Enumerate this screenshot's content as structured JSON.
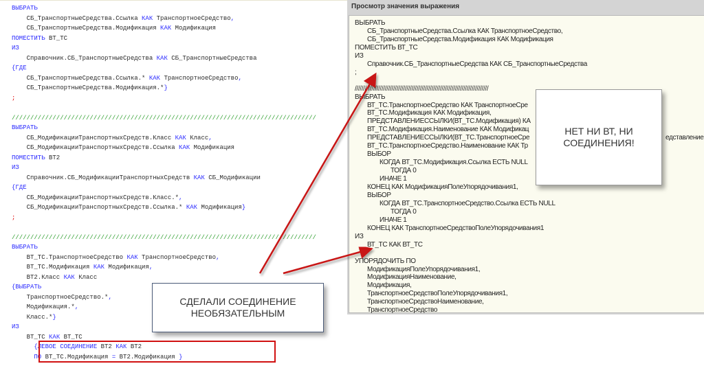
{
  "left_code": [
    [
      [
        "ВЫБРАТЬ",
        "kw"
      ]
    ],
    [
      [
        "    СБ_ТранспортныеСредства.Ссылка ",
        "id"
      ],
      [
        "КАК",
        "kw"
      ],
      [
        " ТранспортноеСредство",
        "id"
      ],
      [
        ",",
        "op"
      ]
    ],
    [
      [
        "    СБ_ТранспортныеСредства.Модификация ",
        "id"
      ],
      [
        "КАК",
        "kw"
      ],
      [
        " Модификация",
        "id"
      ]
    ],
    [
      [
        "ПОМЕСТИТЬ",
        "kw"
      ],
      [
        " ВТ_ТС",
        "id"
      ]
    ],
    [
      [
        "ИЗ",
        "kw"
      ]
    ],
    [
      [
        "    Справочник.СБ_ТранспортныеСредства ",
        "id"
      ],
      [
        "КАК",
        "kw"
      ],
      [
        " СБ_ТранспортныеСредства",
        "id"
      ]
    ],
    [
      [
        "{ГДЕ",
        "op"
      ]
    ],
    [
      [
        "    СБ_ТранспортныеСредства.Ссылка.* ",
        "id"
      ],
      [
        "КАК",
        "kw"
      ],
      [
        " ТранспортноеСредство",
        "id"
      ],
      [
        ",",
        "op"
      ]
    ],
    [
      [
        "    СБ_ТранспортныеСредства.Модификация.*",
        "id"
      ],
      [
        "}",
        "op"
      ]
    ],
    [
      [
        ";",
        "sc"
      ]
    ],
    [],
    [
      [
        "//////////////////////////////////////////////////////////////////////////////////",
        "cm"
      ]
    ],
    [
      [
        "ВЫБРАТЬ",
        "kw"
      ]
    ],
    [
      [
        "    СБ_МодификацииТранспортныхСредств.Класс ",
        "id"
      ],
      [
        "КАК",
        "kw"
      ],
      [
        " Класс",
        "id"
      ],
      [
        ",",
        "op"
      ]
    ],
    [
      [
        "    СБ_МодификацииТранспортныхСредств.Ссылка ",
        "id"
      ],
      [
        "КАК",
        "kw"
      ],
      [
        " Модификация",
        "id"
      ]
    ],
    [
      [
        "ПОМЕСТИТЬ",
        "kw"
      ],
      [
        " ВТ2",
        "id"
      ]
    ],
    [
      [
        "ИЗ",
        "kw"
      ]
    ],
    [
      [
        "    Справочник.СБ_МодификацииТранспортныхСредств ",
        "id"
      ],
      [
        "КАК",
        "kw"
      ],
      [
        " СБ_Модификации",
        "id"
      ]
    ],
    [
      [
        "{ГДЕ",
        "op"
      ]
    ],
    [
      [
        "    СБ_МодификацииТранспортныхСредств.Класс.*",
        "id"
      ],
      [
        ",",
        "op"
      ]
    ],
    [
      [
        "    СБ_МодификацииТранспортныхСредств.Ссылка.* ",
        "id"
      ],
      [
        "КАК",
        "kw"
      ],
      [
        " Модификация",
        "id"
      ],
      [
        "}",
        "op"
      ]
    ],
    [
      [
        ";",
        "sc"
      ]
    ],
    [],
    [
      [
        "//////////////////////////////////////////////////////////////////////////////////",
        "cm"
      ]
    ],
    [
      [
        "ВЫБРАТЬ",
        "kw"
      ]
    ],
    [
      [
        "    ВТ_ТС.ТранспортноеСредство ",
        "id"
      ],
      [
        "КАК",
        "kw"
      ],
      [
        " ТранспортноеСредство",
        "id"
      ],
      [
        ",",
        "op"
      ]
    ],
    [
      [
        "    ВТ_ТС.Модификация ",
        "id"
      ],
      [
        "КАК",
        "kw"
      ],
      [
        " Модификация",
        "id"
      ],
      [
        ",",
        "op"
      ]
    ],
    [
      [
        "    ВТ2.Класс ",
        "id"
      ],
      [
        "КАК",
        "kw"
      ],
      [
        " Класс",
        "id"
      ]
    ],
    [
      [
        "{ВЫБРАТЬ",
        "op"
      ]
    ],
    [
      [
        "    ТранспортноеСредство.*",
        "id"
      ],
      [
        ",",
        "op"
      ]
    ],
    [
      [
        "    Модификация.*",
        "id"
      ],
      [
        ",",
        "op"
      ]
    ],
    [
      [
        "    Класс.*",
        "id"
      ],
      [
        "}",
        "op"
      ]
    ],
    [
      [
        "ИЗ",
        "kw"
      ]
    ],
    [
      [
        "    ВТ_ТС ",
        "id"
      ],
      [
        "КАК",
        "kw"
      ],
      [
        " ВТ_ТС",
        "id"
      ]
    ],
    [
      [
        "      {ЛЕВОЕ СОЕДИНЕНИЕ",
        "op"
      ],
      [
        " ВТ2 ",
        "id"
      ],
      [
        "КАК",
        "kw"
      ],
      [
        " ВТ2",
        "id"
      ]
    ],
    [
      [
        "      ПО",
        "kw"
      ],
      [
        " ВТ_ТС.Модификация ",
        "id"
      ],
      [
        "=",
        "op"
      ],
      [
        " ВТ2.Модификация ",
        "id"
      ],
      [
        "}",
        "op"
      ]
    ]
  ],
  "right_panel": {
    "title": "Просмотр значения выражения",
    "lines": [
      {
        "i": 0,
        "t": "ВЫБРАТЬ"
      },
      {
        "i": 1,
        "t": "СБ_ТранспортныеСредства.Ссылка КАК ТранспортноеСредство,"
      },
      {
        "i": 1,
        "t": "СБ_ТранспортныеСредства.Модификация КАК Модификация"
      },
      {
        "i": 0,
        "t": "ПОМЕСТИТЬ ВТ_ТС"
      },
      {
        "i": 0,
        "t": "ИЗ"
      },
      {
        "i": 1,
        "t": "Справочник.СБ_ТранспортныеСредства КАК СБ_ТранспортныеСредства"
      },
      {
        "i": 0,
        "t": ";"
      },
      {
        "i": 0,
        "t": ""
      },
      {
        "i": 0,
        "t": "////////////////////////////////////////////////////////////////////////////////"
      },
      {
        "i": 0,
        "t": "ВЫБРАТЬ"
      },
      {
        "i": 1,
        "t": "ВТ_ТС.ТранспортноеСредство КАК ТранспортноеСре"
      },
      {
        "i": 1,
        "t": "ВТ_ТС.Модификация КАК Модификация,"
      },
      {
        "i": 1,
        "t": "ПРЕДСТАВЛЕНИЕССЫЛКИ(ВТ_ТС.Модификация) КА"
      },
      {
        "i": 1,
        "t": "ВТ_ТС.Модификация.Наименование КАК Модификац"
      },
      {
        "i": 1,
        "t": "ПРЕДСТАВЛЕНИЕССЫЛКИ(ВТ_ТС.ТранспортноеСре",
        "tail": "едставление,"
      },
      {
        "i": 1,
        "t": "ВТ_ТС.ТранспортноеСредство.Наименование КАК Тр"
      },
      {
        "i": 1,
        "t": "ВЫБОР"
      },
      {
        "i": 2,
        "t": "КОГДА ВТ_ТС.Модификация.Ссылка ЕСТЬ NULL"
      },
      {
        "i": 3,
        "t": "ТОГДА 0"
      },
      {
        "i": 2,
        "t": "ИНАЧЕ 1"
      },
      {
        "i": 1,
        "t": "КОНЕЦ КАК МодификацияПолеУпорядочивания1,"
      },
      {
        "i": 1,
        "t": "ВЫБОР"
      },
      {
        "i": 2,
        "t": "КОГДА ВТ_ТС.ТранспортноеСредство.Ссылка ЕСТЬ NULL"
      },
      {
        "i": 3,
        "t": "ТОГДА 0"
      },
      {
        "i": 2,
        "t": "ИНАЧЕ 1"
      },
      {
        "i": 1,
        "t": "КОНЕЦ КАК ТранспортноеСредствоПолеУпорядочивания1"
      },
      {
        "i": 0,
        "t": "ИЗ"
      },
      {
        "i": 1,
        "t": "ВТ_ТС КАК ВТ_ТС"
      },
      {
        "i": 0,
        "t": ""
      },
      {
        "i": 0,
        "t": "УПОРЯДОЧИТЬ ПО"
      },
      {
        "i": 1,
        "t": "МодификацияПолеУпорядочивания1,"
      },
      {
        "i": 1,
        "t": "МодификацияНаименование,"
      },
      {
        "i": 1,
        "t": "Модификация,"
      },
      {
        "i": 1,
        "t": "ТранспортноеСредствоПолеУпорядочивания1,"
      },
      {
        "i": 1,
        "t": "ТранспортноеСредствоНаименование,"
      },
      {
        "i": 1,
        "t": "ТранспортноеСредство"
      }
    ]
  },
  "callouts": {
    "right": [
      "НЕТ НИ ВТ, НИ",
      "СОЕДИНЕНИЯ!"
    ],
    "left": [
      "СДЕЛАЛИ СОЕДИНЕНИЕ",
      "НЕОБЯЗАТЕЛЬНЫМ"
    ]
  },
  "colors": {
    "keyword": "#2a2aff",
    "comment": "#2e9e2e",
    "semicolon": "#e00000",
    "arrow": "#c81414",
    "highlight_box": "#d01010"
  }
}
